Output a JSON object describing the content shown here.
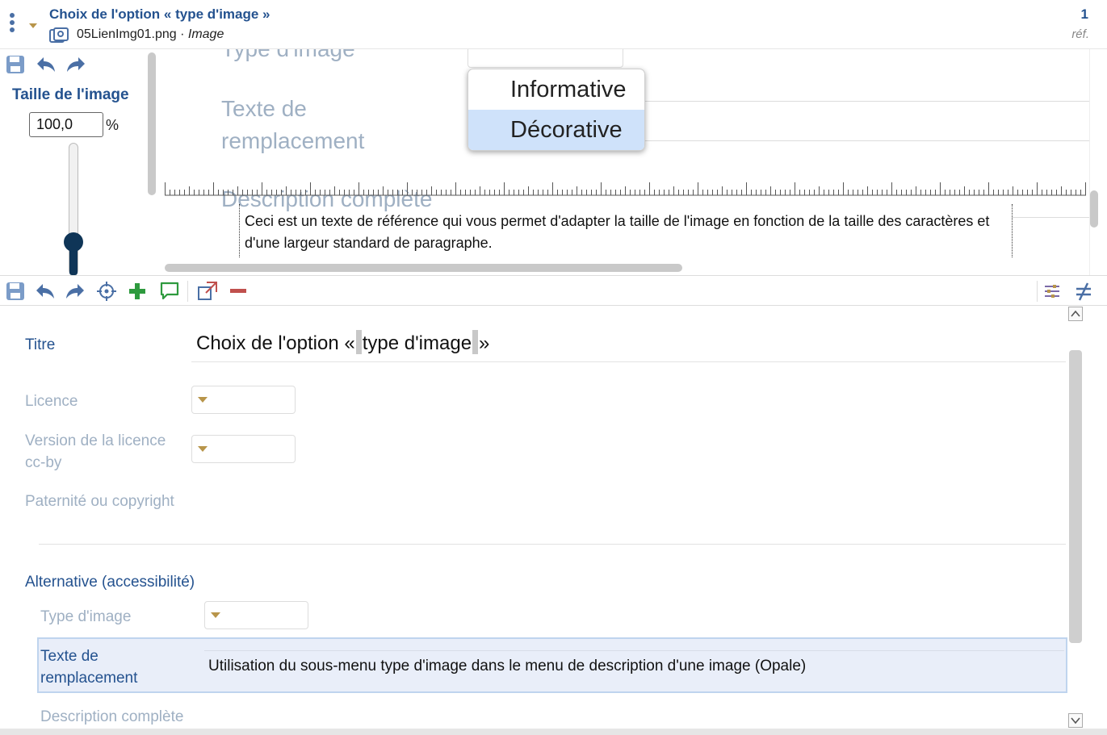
{
  "header": {
    "title": "Choix de l'option « type d'image »",
    "filename": "05LienImg01.png",
    "separator": " · ",
    "type": "Image",
    "count": "1",
    "ref_label": "réf."
  },
  "size_panel": {
    "label": "Taille de l'image",
    "value": "100,0",
    "unit": "%",
    "slider_level": 1.0
  },
  "preview": {
    "ghost_type": "Type d'image",
    "ghost_text_1": "Texte de",
    "ghost_text_2": "remplacement",
    "ghost_desc": "Description complète",
    "dropdown_options": [
      "Informative",
      "Décorative"
    ],
    "dropdown_selected": "Décorative",
    "reference_text": "Ceci est un texte de référence qui vous permet d'adapter la taille de l'image en fonction de la taille des caractères et d'une largeur standard de paragraphe."
  },
  "toolbar": {
    "icons": [
      "save-icon",
      "undo-icon",
      "redo-icon",
      "target-icon",
      "add-icon",
      "comment-icon",
      "open-external-icon",
      "remove-icon",
      "filter-icon",
      "not-equal-icon"
    ]
  },
  "form": {
    "titre_label": "Titre",
    "titre_before": "Choix de l'option «",
    "titre_mid": "type d'image",
    "titre_after": "»",
    "licence_label": "Licence",
    "version_label_1": "Version de la licence",
    "version_label_2": "cc-by",
    "paternite_label": "Paternité ou copyright",
    "alternative_label": "Alternative (accessibilité)",
    "type_image_label": "Type d'image",
    "texte_label_1": "Texte de",
    "texte_label_2": "remplacement",
    "texte_value": "Utilisation du sous-menu type d'image dans le menu de description d'une image (Opale)",
    "description_label": "Description complète"
  },
  "colors": {
    "accent_blue": "#24528f",
    "muted_label": "#9fb0c3",
    "dropdown_caret": "#b8954a",
    "add_green": "#2e9a3e",
    "remove_red": "#c0504d",
    "selected_bg": "#cfe2fa"
  }
}
